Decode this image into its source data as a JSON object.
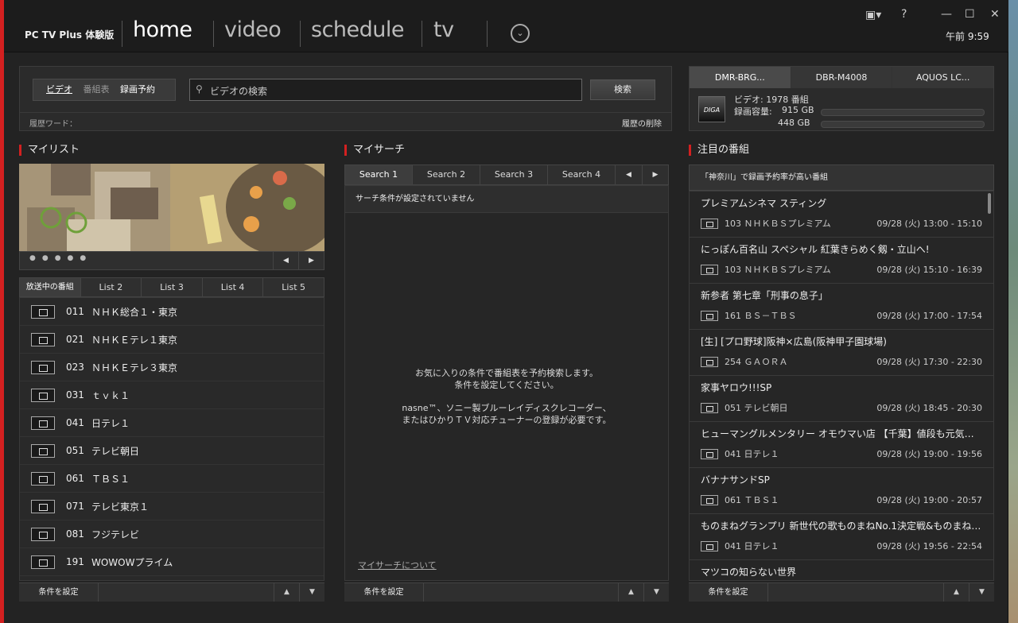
{
  "app": {
    "name": "PC TV Plus 体験版",
    "time": "午前 9:59"
  },
  "nav": {
    "home": "home",
    "video": "video",
    "schedule": "schedule",
    "tv": "tv"
  },
  "search": {
    "mode_video": "ビデオ",
    "mode_guide": "番組表",
    "mode_rec": "録画予約",
    "placeholder": "ビデオの検索",
    "button": "検索",
    "history_label": "履歴ワード：",
    "history_clear": "履歴の削除"
  },
  "devices": {
    "tabs": [
      "DMR-BRG...",
      "DBR-M4008",
      "AQUOS LC..."
    ],
    "video_label": "ビデオ:",
    "video_count": "1978 番組",
    "capacity_label": "録画容量:",
    "cap1": "915 GB",
    "cap2": "448 GB",
    "logo": "DIGA"
  },
  "mylist": {
    "title": "マイリスト",
    "tabs": [
      "放送中の番組",
      "List 2",
      "List 3",
      "List 4",
      "List 5"
    ],
    "channels": [
      {
        "num": "011",
        "name": "ＮＨＫ総合１・東京"
      },
      {
        "num": "021",
        "name": "ＮＨＫＥテレ１東京"
      },
      {
        "num": "023",
        "name": "ＮＨＫＥテレ３東京"
      },
      {
        "num": "031",
        "name": "ｔｖｋ１"
      },
      {
        "num": "041",
        "name": "日テレ１"
      },
      {
        "num": "051",
        "name": "テレビ朝日"
      },
      {
        "num": "061",
        "name": "ＴＢＳ１"
      },
      {
        "num": "071",
        "name": "テレビ東京１"
      },
      {
        "num": "081",
        "name": "フジテレビ"
      },
      {
        "num": "191",
        "name": "WOWOWプライム"
      }
    ],
    "footer": "条件を設定"
  },
  "mysearch": {
    "title": "マイサーチ",
    "tabs": [
      "Search 1",
      "Search 2",
      "Search 3",
      "Search 4"
    ],
    "status": "サーチ条件が設定されていません",
    "msg1": "お気に入りの条件で番組表を予約検索します。",
    "msg2": "条件を設定してください。",
    "msg3": "nasne™、ソニー製ブルーレイディスクレコーダー、",
    "msg4": "またはひかりＴＶ対応チューナーの登録が必要です。",
    "about": "マイサーチについて",
    "footer": "条件を設定"
  },
  "featured": {
    "title": "注目の番組",
    "subtitle": "「神奈川」で録画予約率が高い番組",
    "programs": [
      {
        "title": "プレミアムシネマ スティング",
        "ch": "103 ＮＨＫＢＳプレミアム",
        "time": "09/28 (火) 13:00 - 15:10"
      },
      {
        "title": "にっぽん百名山 スペシャル 紅葉きらめく剱・立山へ!",
        "ch": "103 ＮＨＫＢＳプレミアム",
        "time": "09/28 (火) 15:10 - 16:39"
      },
      {
        "title": "新参者 第七章「刑事の息子」",
        "ch": "161 ＢＳ－ＴＢＳ",
        "time": "09/28 (火) 17:00 - 17:54"
      },
      {
        "title": "[生] [プロ野球]阪神×広島(阪神甲子園球場)",
        "ch": "254 ＧＡＯＲＡ",
        "time": "09/28 (火) 17:30 - 22:30"
      },
      {
        "title": "家事ヤロウ!!!SP",
        "ch": "051 テレビ朝日",
        "time": "09/28 (火) 18:45 - 20:30"
      },
      {
        "title": "ヒューマングルメンタリー オモウマい店 【千葉】値段も元気も...",
        "ch": "041 日テレ１",
        "time": "09/28 (火) 19:00 - 19:56"
      },
      {
        "title": "バナナサンドSP",
        "ch": "061 ＴＢＳ１",
        "time": "09/28 (火) 19:00 - 20:57"
      },
      {
        "title": "ものまねグランプリ 新世代の歌ものまねNo.1決定戦&ものまね芸...",
        "ch": "041 日テレ１",
        "time": "09/28 (火) 19:56 - 22:54"
      },
      {
        "title": "マツコの知らない世界",
        "ch": "",
        "time": ""
      }
    ],
    "footer": "条件を設定"
  }
}
